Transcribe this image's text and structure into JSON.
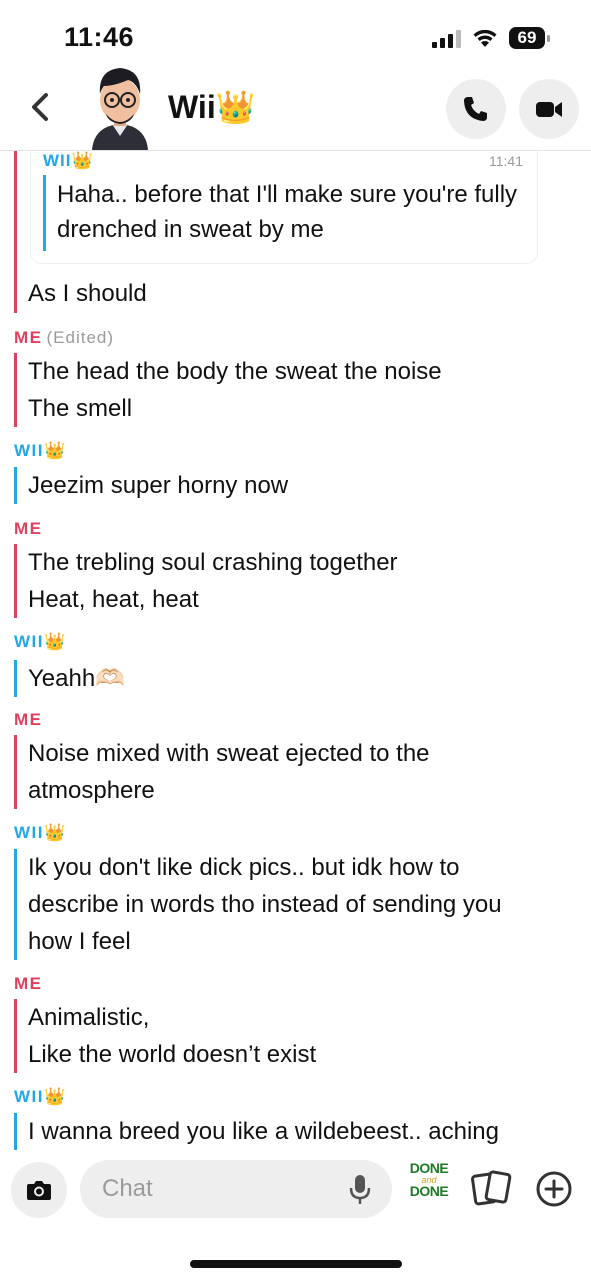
{
  "status_bar": {
    "time": "11:46",
    "battery": "69"
  },
  "header": {
    "contact_name": "Wii👑"
  },
  "quoted": {
    "sender": "WII👑",
    "time": "11:41",
    "text": "Haha.. before that I'll make sure you're fully drenched in sweat by me"
  },
  "first_reply": "As I should",
  "messages": [
    {
      "sender": "ME",
      "edited": "(Edited)",
      "text": "The head the body the sweat the noise\nThe smell"
    },
    {
      "sender": "WII👑",
      "text": "Jeezim super horny now"
    },
    {
      "sender": "ME",
      "text": "The trebling soul crashing together\nHeat, heat, heat"
    },
    {
      "sender": "WII👑",
      "text": "Yeahh🫶🏻"
    },
    {
      "sender": "ME",
      "text": "Noise mixed with sweat ejected to the\natmosphere"
    },
    {
      "sender": "WII👑",
      "text": "Ik you don't like dick pics.. but idk how to\ndescribe in words tho instead of sending you\nhow I feel"
    },
    {
      "sender": "ME",
      "text": "Animalistic,\nLike the world doesn’t exist"
    },
    {
      "sender": "WII👑",
      "text": "I wanna breed you like a wildebeest.. aching"
    }
  ],
  "composer": {
    "placeholder": "Chat",
    "sticker_top": "DONE",
    "sticker_mid": "and",
    "sticker_bottom": "DONE"
  },
  "icons": [
    "back-icon",
    "phone-icon",
    "video-icon",
    "camera-icon",
    "microphone-icon",
    "cards-icon",
    "plus-icon"
  ],
  "colors": {
    "me": "#e0405d",
    "friend": "#22a8e6",
    "bubble_bg": "#eeeeee"
  }
}
